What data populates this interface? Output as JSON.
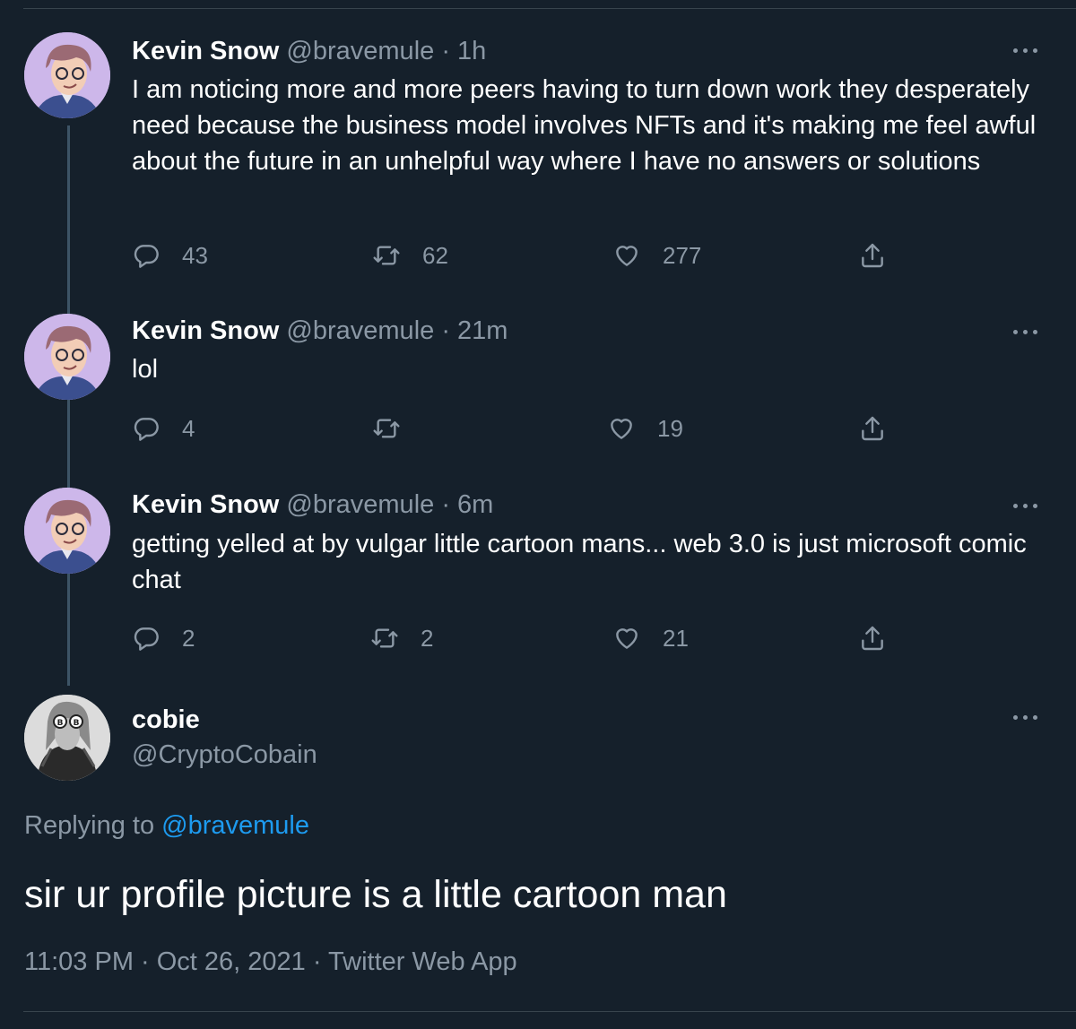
{
  "thread": [
    {
      "name": "Kevin Snow",
      "handle": "@bravemule",
      "time": "· 1h",
      "text": "I am noticing more and more peers having to turn down work they desperately need because the business model involves NFTs and it's making me feel awful about the future in an unhelpful way where I have no answers or solutions",
      "replies": "43",
      "retweets": "62",
      "likes": "277"
    },
    {
      "name": "Kevin Snow",
      "handle": "@bravemule",
      "time": "· 21m",
      "text": "lol",
      "replies": "4",
      "retweets": "",
      "likes": "19"
    },
    {
      "name": "Kevin Snow",
      "handle": "@bravemule",
      "time": "· 6m",
      "text": "getting yelled at by vulgar little cartoon mans...  web 3.0 is just microsoft comic chat",
      "replies": "2",
      "retweets": "2",
      "likes": "21"
    }
  ],
  "main": {
    "name": "cobie",
    "handle": "@CryptoCobain",
    "replying_prefix": "Replying to",
    "replying_to": "@bravemule",
    "text": "sir ur profile picture is a little cartoon man",
    "meta": "11:03 PM · Oct 26, 2021 · Twitter Web App"
  },
  "icons": {
    "reply": "reply-icon",
    "retweet": "retweet-icon",
    "like": "heart-icon",
    "share": "share-icon",
    "more": "more-icon"
  },
  "colors": {
    "background": "#15202b",
    "secondary_text": "#8b98a5",
    "link": "#1d9bf0",
    "thread_line": "#3d5466"
  }
}
